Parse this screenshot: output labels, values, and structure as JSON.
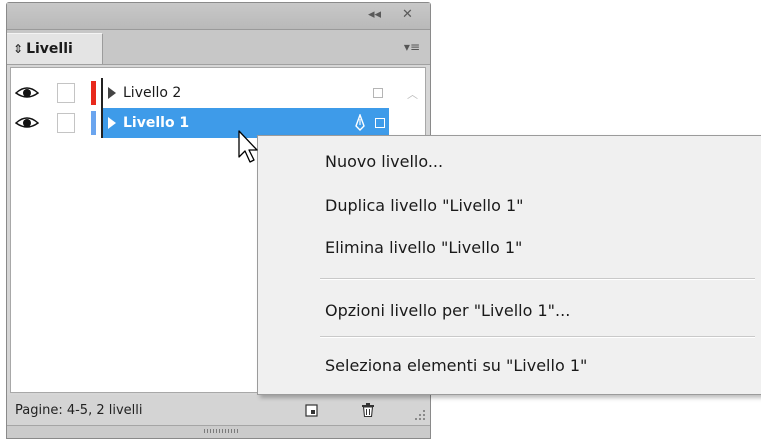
{
  "panel": {
    "title_buttons": {
      "collapse": "◂◂",
      "close": "✕"
    },
    "tab_label": "Livelli",
    "tab_sort_glyph": "⇕",
    "menu_glyph": "▾≡",
    "layers": [
      {
        "name": "Livello 2",
        "color": "#e8291c",
        "selected": false
      },
      {
        "name": "Livello 1",
        "color": "#6aa5ef",
        "selected": true
      }
    ],
    "footer_text": "Pagine: 4-5, 2 livelli"
  },
  "context_menu": {
    "items": [
      "Nuovo livello...",
      "Duplica livello \"Livello 1\"",
      "Elimina livello \"Livello 1\"",
      "Opzioni livello per \"Livello 1\"...",
      "Seleziona elementi su \"Livello 1\""
    ]
  },
  "colors": {
    "selection": "#3e9be9"
  }
}
